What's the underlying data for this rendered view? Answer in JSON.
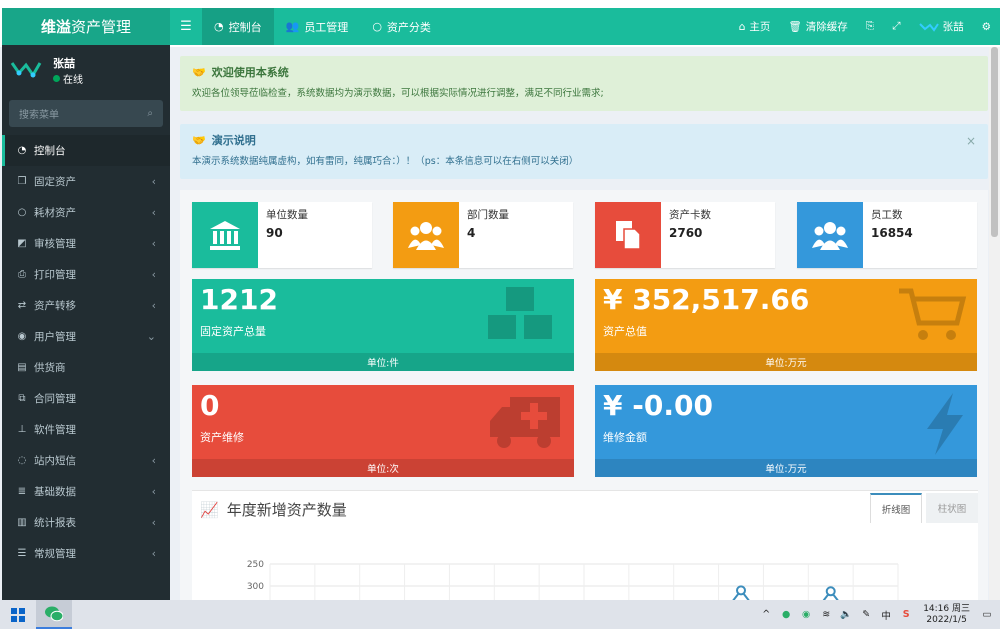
{
  "brand": {
    "bold": "维溢",
    "rest": "资产管理"
  },
  "nav": {
    "tabs": [
      {
        "label": "控制台",
        "icon": "dashboard-icon"
      },
      {
        "label": "员工管理",
        "icon": "users-icon"
      },
      {
        "label": "资产分类",
        "icon": "circle-icon"
      }
    ],
    "right": {
      "home": "主页",
      "clear_cache": "清除缓存",
      "user": "张喆"
    }
  },
  "sidebar": {
    "user_name": "张喆",
    "status": "在线",
    "search_placeholder": "搜索菜单",
    "items": [
      {
        "label": "控制台",
        "icon": "dashboard-icon",
        "chevron": ""
      },
      {
        "label": "固定资产",
        "icon": "cubes-icon",
        "chevron": "‹"
      },
      {
        "label": "耗材资产",
        "icon": "circle-icon",
        "chevron": "‹"
      },
      {
        "label": "审核管理",
        "icon": "check-icon",
        "chevron": "‹"
      },
      {
        "label": "打印管理",
        "icon": "print-icon",
        "chevron": "‹"
      },
      {
        "label": "资产转移",
        "icon": "exchange-icon",
        "chevron": "‹"
      },
      {
        "label": "用户管理",
        "icon": "user-icon",
        "chevron": "⌄"
      },
      {
        "label": "供货商",
        "icon": "briefcase-icon",
        "chevron": ""
      },
      {
        "label": "合同管理",
        "icon": "copy-icon",
        "chevron": ""
      },
      {
        "label": "软件管理",
        "icon": "sitemap-icon",
        "chevron": ""
      },
      {
        "label": "站内短信",
        "icon": "comment-icon",
        "chevron": "‹"
      },
      {
        "label": "基础数据",
        "icon": "database-icon",
        "chevron": "‹"
      },
      {
        "label": "统计报表",
        "icon": "bar-chart-icon",
        "chevron": "‹"
      },
      {
        "label": "常规管理",
        "icon": "list-icon",
        "chevron": "‹"
      }
    ]
  },
  "callouts": {
    "welcome": {
      "title": "欢迎使用本系统",
      "text": "欢迎各位领导莅临检查，系统数据均为演示数据，可以根据实际情况进行调整，满足不同行业需求;"
    },
    "demo": {
      "title": "演示说明",
      "text": "本演示系统数据纯属虚构，如有雷同，纯属巧合：）！（ps：本条信息可以在右侧可以关闭）",
      "close": "×"
    }
  },
  "info_boxes": [
    {
      "label": "单位数量",
      "value": "90",
      "color": "#1abc9c",
      "icon": "bank-icon"
    },
    {
      "label": "部门数量",
      "value": "4",
      "color": "#f39c12",
      "icon": "users-icon"
    },
    {
      "label": "资产卡数",
      "value": "2760",
      "color": "#e74c3c",
      "icon": "files-icon"
    },
    {
      "label": "员工数",
      "value": "16854",
      "color": "#3498db",
      "icon": "users-icon"
    }
  ],
  "small_boxes": [
    {
      "value": "1212",
      "label": "固定资产总量",
      "footer": "单位:件",
      "color": "#1abc9c",
      "icon": "cubes-icon"
    },
    {
      "value": "¥ 352,517.66",
      "label": "资产总值",
      "footer": "单位:万元",
      "color": "#f39c12",
      "icon": "cart-icon"
    },
    {
      "value": "0",
      "label": "资产维修",
      "footer": "单位:次",
      "color": "#e74c3c",
      "icon": "ambulance-icon"
    },
    {
      "value": "¥ -0.00",
      "label": "维修金额",
      "footer": "单位:万元",
      "color": "#3498db",
      "icon": "bolt-icon"
    }
  ],
  "chart": {
    "title": "年度新增资产数量",
    "tabs": [
      "折线图",
      "柱状图"
    ],
    "y_ticks": [
      "300",
      "250"
    ]
  },
  "chart_data": {
    "type": "line",
    "title": "年度新增资产数量",
    "ylim": [
      0,
      300
    ],
    "y_ticks": [
      250,
      300
    ],
    "grid": true,
    "series": [
      {
        "values": [
          null,
          null,
          null,
          null,
          null,
          null,
          null,
          null,
          null,
          null,
          240,
          null,
          238,
          null
        ]
      }
    ]
  },
  "taskbar": {
    "time": "14:16 周三",
    "date": "2022/1/5",
    "ime": "中"
  }
}
